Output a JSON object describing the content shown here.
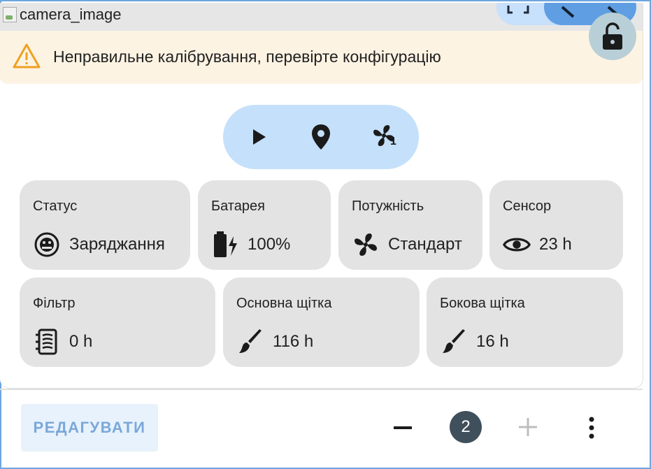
{
  "camera": {
    "alt_text": "camera_image"
  },
  "warning": {
    "text": "Неправильне калібрування, перевірте конфігурацію"
  },
  "tiles": [
    {
      "label": "Статус",
      "value": "Заряджання",
      "icon": "robot-vacuum-icon"
    },
    {
      "label": "Батарея",
      "value": "100%",
      "icon": "battery-charging-icon"
    },
    {
      "label": "Потужність",
      "value": "Стандарт",
      "icon": "fan-icon"
    },
    {
      "label": "Сенсор",
      "value": "23 h",
      "icon": "eye-icon"
    },
    {
      "label": "Фільтр",
      "value": "0 h",
      "icon": "filter-icon"
    },
    {
      "label": "Основна щітка",
      "value": "116 h",
      "icon": "brush-icon"
    },
    {
      "label": "Бокова щітка",
      "value": "16 h",
      "icon": "brush-icon"
    }
  ],
  "controls": {
    "fan_speed_badge": "1"
  },
  "footer": {
    "edit_label": "РЕДАГУВАТИ",
    "count": "2"
  },
  "colors": {
    "accent": "#5f9ee3",
    "control_bg": "#c5e0fa",
    "warning_bg": "#fdf3e3",
    "warning_icon": "#f0a020",
    "tile_bg": "#e3e3e3"
  }
}
